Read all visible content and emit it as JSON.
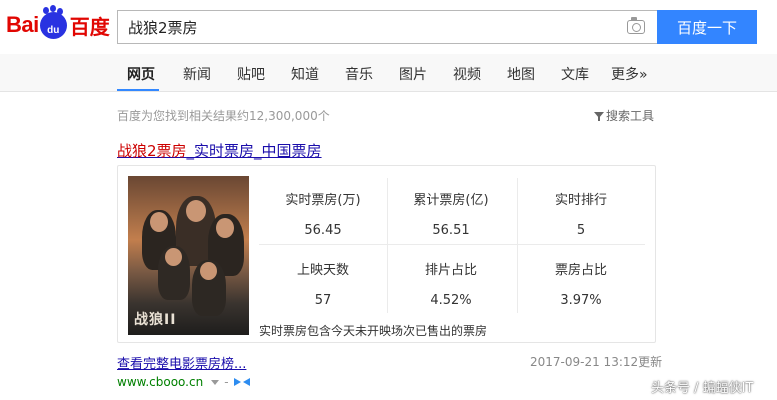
{
  "header": {
    "logo_bai": "Bai",
    "logo_du": "du",
    "logo_cn": "百度",
    "query": "战狼2票房",
    "search_button": "百度一下"
  },
  "nav": [
    "网页",
    "新闻",
    "贴吧",
    "知道",
    "音乐",
    "图片",
    "视频",
    "地图",
    "文库",
    "更多»"
  ],
  "meta": {
    "result_count": "百度为您找到相关结果约12,300,000个",
    "search_tools": "搜索工具"
  },
  "result": {
    "title_highlight": "战狼2票房",
    "title_rest": "_实时票房_中国票房",
    "poster_title": "战狼II",
    "stats": [
      {
        "label": "实时票房(万)",
        "value": "56.45"
      },
      {
        "label": "累计票房(亿)",
        "value": "56.51"
      },
      {
        "label": "实时排行",
        "value": "5"
      },
      {
        "label": "上映天数",
        "value": "57"
      },
      {
        "label": "排片占比",
        "value": "4.52%"
      },
      {
        "label": "票房占比",
        "value": "3.97%"
      }
    ],
    "note": "实时票房包含今天未开映场次已售出的票房",
    "more_link": "查看完整电影票房榜...",
    "updated": "2017-09-21 13:12更新",
    "url": "www.cbooo.cn",
    "dash": "-"
  },
  "watermark": "头条号 / 蝙蝠侠IT",
  "colors": {
    "accent": "#3385ff",
    "link": "#1a0dab",
    "highlight": "#cc0000",
    "url": "#008000"
  }
}
